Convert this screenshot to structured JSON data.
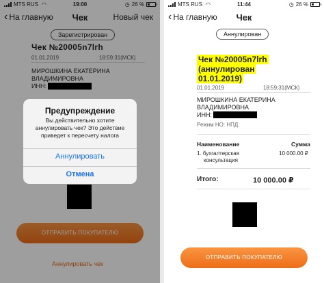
{
  "left": {
    "status": {
      "carrier": "MTS RUS",
      "time": "19:00",
      "battery": "26 %",
      "battery_level": 0.26
    },
    "nav": {
      "back_label": "На главную",
      "title": "Чек",
      "action_label": "Новый чек"
    },
    "receipt": {
      "status_badge": "Зарегистрирован",
      "number": "Чек №20005n7lrh",
      "date": "01.01.2019",
      "time_tz": "18:59:31(МСК)",
      "name_line1": "МИРОШКИНА ЕКАТЕРИНА",
      "name_line2": "ВЛАДИМИРОВНА",
      "inn_label": "ИНН:"
    },
    "alert": {
      "title": "Предупреждение",
      "message": "Вы действительно хотите аннулировать чек? Это действие приведет к пересчету налога",
      "confirm_label": "Аннулировать",
      "cancel_label": "Отмена"
    },
    "send_button_label": "ОТПРАВИТЬ ПОКУПАТЕЛЮ",
    "annul_link_label": "Аннулировать чек"
  },
  "right": {
    "status": {
      "carrier": "MTS RUS",
      "time": "11:44",
      "battery": "26 %",
      "battery_level": 0.26
    },
    "nav": {
      "back_label": "На главную",
      "title": "Чек"
    },
    "receipt": {
      "status_badge": "Аннулирован",
      "number": "Чек №20005n7lrh",
      "annul_line1": "(аннулирован",
      "annul_line2": "01.01.2019)",
      "date": "01.01.2019",
      "time_tz": "18:59:31(МСК)",
      "name_line1": "МИРОШКИНА ЕКАТЕРИНА",
      "name_line2": "ВЛАДИМИРОВНА",
      "inn_label": "ИНН:",
      "tax_mode": "Режим НО: НПД",
      "col_name": "Наименование",
      "col_sum": "Сумма",
      "item_line1": "1. бухгалтерская",
      "item_line2": "консультация",
      "item_sum": "10 000.00 ₽",
      "total_label": "Итого:",
      "total_value": "10 000.00 ₽"
    },
    "send_button_label": "ОТПРАВИТЬ ПОКУПАТЕЛЮ"
  }
}
